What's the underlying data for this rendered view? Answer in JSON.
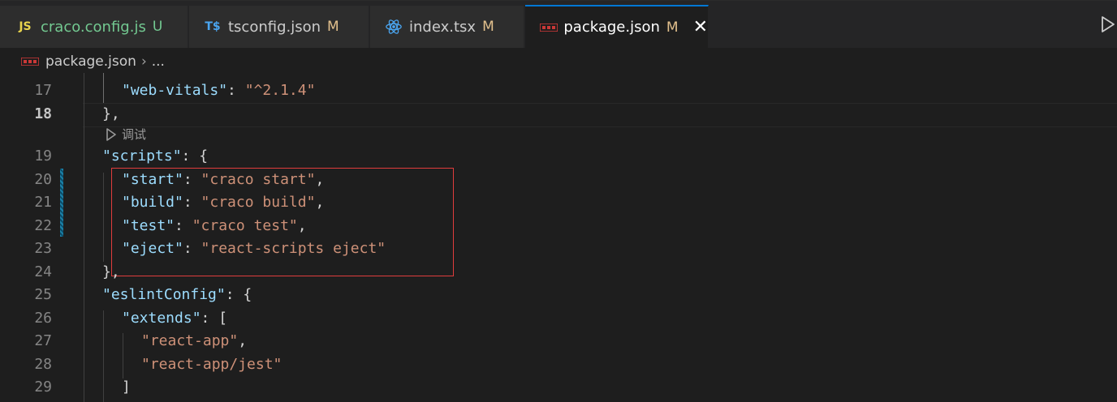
{
  "tabs": [
    {
      "icon": "js-file-icon",
      "icon_text": "JS",
      "name": "craco.config.js",
      "badge": "U",
      "badge_color": "#73c991",
      "name_color": "#73c991",
      "active": false
    },
    {
      "icon": "typescript-config-icon",
      "icon_text": "T$",
      "name": "tsconfig.json",
      "badge": "M",
      "badge_color": "#e2c08d",
      "active": false
    },
    {
      "icon": "react-icon",
      "name": "index.tsx",
      "badge": "M",
      "badge_color": "#e2c08d",
      "active": false
    },
    {
      "icon": "npm-icon",
      "name": "package.json",
      "badge": "M",
      "badge_color": "#e2c08d",
      "active": true,
      "close_glyph": "✕"
    }
  ],
  "breadcrumb": {
    "file": "package.json",
    "separator": "›",
    "ellipsis": "..."
  },
  "codelens": {
    "label": "调试"
  },
  "editor": {
    "current_line": 18,
    "lines": [
      {
        "num": "17",
        "tokens": [
          {
            "t": "k",
            "v": "\"web-vitals\""
          },
          {
            "t": "p",
            "v": ": "
          },
          {
            "t": "s",
            "v": "\"^2.1.4\""
          }
        ]
      },
      {
        "num": "18",
        "tokens": [
          {
            "t": "p",
            "v": "},"
          }
        ]
      },
      {
        "num": "19",
        "tokens": [
          {
            "t": "k",
            "v": "\"scripts\""
          },
          {
            "t": "p",
            "v": ": {"
          }
        ]
      },
      {
        "num": "20",
        "tokens": [
          {
            "t": "k",
            "v": "\"start\""
          },
          {
            "t": "p",
            "v": ": "
          },
          {
            "t": "s",
            "v": "\"craco start\""
          },
          {
            "t": "p",
            "v": ","
          }
        ]
      },
      {
        "num": "21",
        "tokens": [
          {
            "t": "k",
            "v": "\"build\""
          },
          {
            "t": "p",
            "v": ": "
          },
          {
            "t": "s",
            "v": "\"craco build\""
          },
          {
            "t": "p",
            "v": ","
          }
        ]
      },
      {
        "num": "22",
        "tokens": [
          {
            "t": "k",
            "v": "\"test\""
          },
          {
            "t": "p",
            "v": ": "
          },
          {
            "t": "s",
            "v": "\"craco test\""
          },
          {
            "t": "p",
            "v": ","
          }
        ]
      },
      {
        "num": "23",
        "tokens": [
          {
            "t": "k",
            "v": "\"eject\""
          },
          {
            "t": "p",
            "v": ": "
          },
          {
            "t": "s",
            "v": "\"react-scripts eject\""
          }
        ]
      },
      {
        "num": "24",
        "tokens": [
          {
            "t": "p",
            "v": "},"
          }
        ]
      },
      {
        "num": "25",
        "tokens": [
          {
            "t": "k",
            "v": "\"eslintConfig\""
          },
          {
            "t": "p",
            "v": ": {"
          }
        ]
      },
      {
        "num": "26",
        "tokens": [
          {
            "t": "k",
            "v": "\"extends\""
          },
          {
            "t": "p",
            "v": ": ["
          }
        ]
      },
      {
        "num": "27",
        "tokens": [
          {
            "t": "s",
            "v": "\"react-app\""
          },
          {
            "t": "p",
            "v": ","
          }
        ]
      },
      {
        "num": "28",
        "tokens": [
          {
            "t": "s",
            "v": "\"react-app/jest\""
          }
        ]
      },
      {
        "num": "29",
        "tokens": [
          {
            "t": "p",
            "v": "]"
          }
        ]
      }
    ]
  },
  "colors": {
    "accent": "#0078d4",
    "highlight_box": "#e03c3c",
    "json_key": "#9cdcfe",
    "json_string": "#ce9178"
  }
}
